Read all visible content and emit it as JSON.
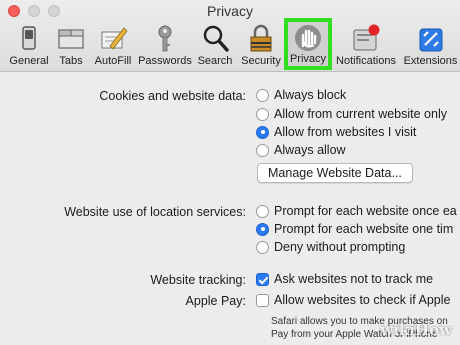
{
  "window": {
    "title": "Privacy"
  },
  "toolbar": {
    "items": [
      {
        "label": "General",
        "icon": "general-switch-icon"
      },
      {
        "label": "Tabs",
        "icon": "tabs-icon"
      },
      {
        "label": "AutoFill",
        "icon": "autofill-pencil-icon"
      },
      {
        "label": "Passwords",
        "icon": "key-icon"
      },
      {
        "label": "Search",
        "icon": "magnifier-icon"
      },
      {
        "label": "Security",
        "icon": "padlock-icon"
      },
      {
        "label": "Privacy",
        "icon": "hand-icon",
        "selected": true
      },
      {
        "label": "Notifications",
        "icon": "notification-badge-icon"
      },
      {
        "label": "Extensions",
        "icon": "puzzle-icon"
      }
    ],
    "highlight_color": "#33dd22"
  },
  "cookies": {
    "label": "Cookies and website data:",
    "options": [
      "Always block",
      "Allow from current website only",
      "Allow from websites I visit",
      "Always allow"
    ],
    "selected_index": 2,
    "manage_button": "Manage Website Data..."
  },
  "location": {
    "label": "Website use of location services:",
    "options": [
      "Prompt for each website once ea",
      "Prompt for each website one tim",
      "Deny without prompting"
    ],
    "selected_index": 1
  },
  "tracking": {
    "label": "Website tracking:",
    "checkbox_label": "Ask websites not to track me",
    "checked": true
  },
  "apple_pay": {
    "label": "Apple Pay:",
    "checkbox_label": "Allow websites to check if Apple",
    "checked": false,
    "note_line1": "Safari allows you to make purchases on",
    "note_line2": "Pay from your Apple Watch or iPhone"
  },
  "watermark": "wikiHow",
  "colors": {
    "accent": "#2a7af2",
    "close_button": "#fc605c"
  }
}
